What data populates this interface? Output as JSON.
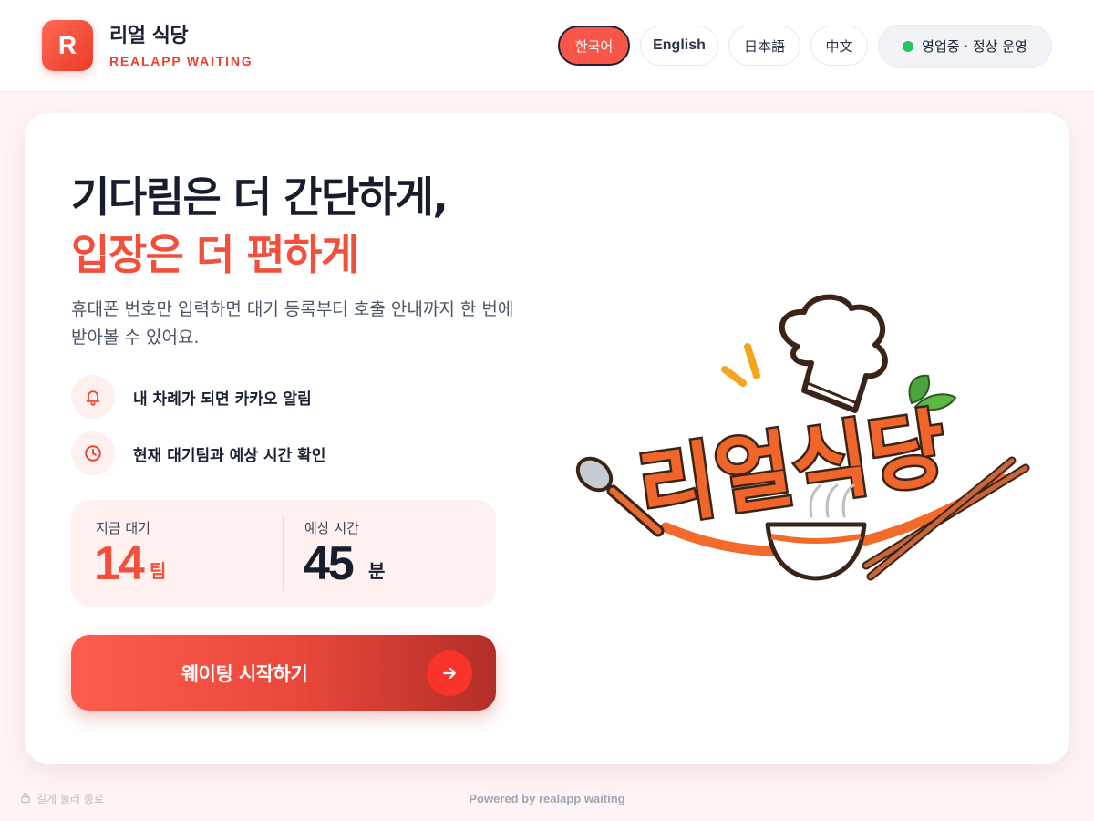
{
  "brand": {
    "logo_letter": "R",
    "name": "리얼 식당",
    "subtitle": "REALAPP WAITING"
  },
  "languages": [
    {
      "label": "한국어",
      "selected": true
    },
    {
      "label": "English",
      "selected": false
    },
    {
      "label": "日本語",
      "selected": false
    },
    {
      "label": "中文",
      "selected": false
    }
  ],
  "status": {
    "label": "영업중 · 정상 운영",
    "color": "#22c55e"
  },
  "hero": {
    "line1": "기다림은 더 간단하게,",
    "line2": "입장은 더 편하게",
    "description": "휴대폰 번호만 입력하면 대기 등록부터 호출 안내까지 한 번에 받아볼 수 있어요."
  },
  "features": [
    {
      "icon": "bell-icon",
      "label": "내 차례가 되면 카카오 알림"
    },
    {
      "icon": "clock-icon",
      "label": "현재 대기팀과 예상 시간 확인"
    }
  ],
  "stats": {
    "waiting": {
      "label": "지금 대기",
      "value": "14",
      "unit": "팀"
    },
    "eta": {
      "label": "예상 시간",
      "value": "45",
      "unit": "분"
    }
  },
  "cta": {
    "label": "웨이팅 시작하기"
  },
  "illustration": {
    "logo_text": "리얼식당"
  },
  "footer": {
    "exit_hint": "길게 눌러 종료",
    "powered_by": "Powered by realapp waiting"
  },
  "colors": {
    "accent": "#f2503c",
    "dark": "#161d2d",
    "background": "#fdf4f3"
  }
}
